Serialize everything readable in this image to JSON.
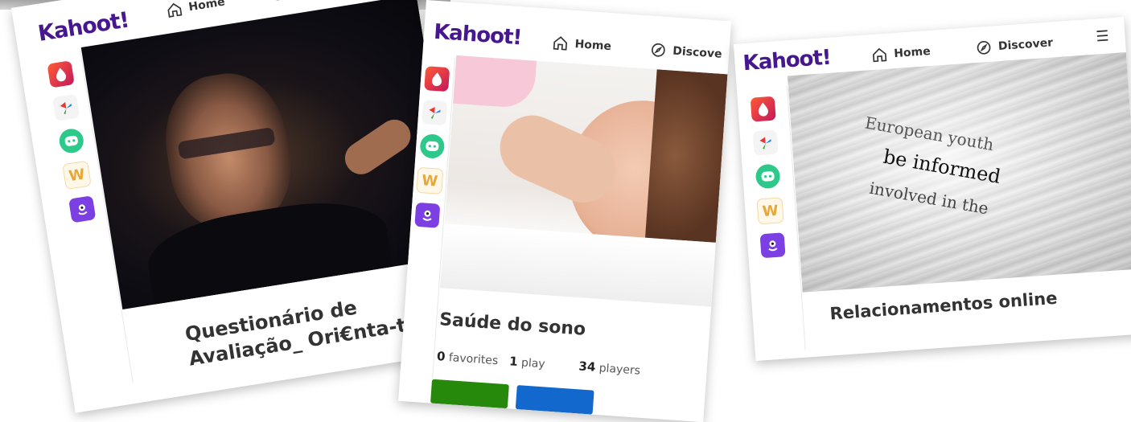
{
  "nav": {
    "logo": "Kahoot!",
    "home_label": "Home",
    "discover_label": "Discover",
    "discover_clipped": "Discove"
  },
  "cards": [
    {
      "title_line1": "Questionário de",
      "title_line2": "Avaliação_ Ori€nta-te_"
    },
    {
      "title": "Saúde do sono",
      "favorites_count": "0",
      "favorites_label": "favorites",
      "plays_count": "1",
      "plays_label": "play",
      "players_count": "34",
      "players_label": "players"
    },
    {
      "title": "Relacionamentos online",
      "photo_text_line1": "European youth",
      "photo_text_line2": "be informed",
      "photo_text_line3": "involved in the"
    }
  ],
  "apps": [
    "drops-app-icon",
    "pyramid-app-icon",
    "chat-robot-app-icon",
    "wordpower-app-icon",
    "monster-app-icon"
  ],
  "colors": {
    "brand": "#46178f",
    "green_button": "#26890c",
    "blue_button": "#1368ce"
  }
}
